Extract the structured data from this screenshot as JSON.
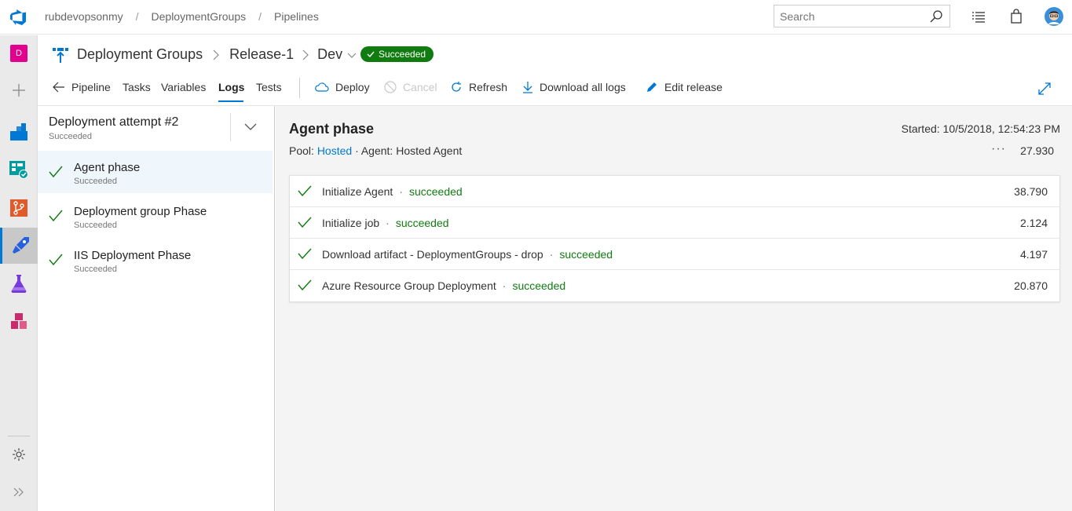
{
  "topbar": {
    "breadcrumbs": [
      "rubdevopsonmy",
      "DeploymentGroups",
      "Pipelines"
    ],
    "search_placeholder": "Search"
  },
  "leftnav": {
    "project_initial": "D"
  },
  "header": {
    "crumbs": [
      "Deployment Groups",
      "Release-1",
      "Dev"
    ],
    "status": "Succeeded"
  },
  "toolbar": {
    "back_label": "Pipeline",
    "tabs": [
      "Tasks",
      "Variables",
      "Logs",
      "Tests"
    ],
    "active_tab": "Logs",
    "deploy": "Deploy",
    "cancel": "Cancel",
    "refresh": "Refresh",
    "download": "Download all logs",
    "edit": "Edit release"
  },
  "attempt": {
    "title": "Deployment attempt #2",
    "status": "Succeeded"
  },
  "phases": [
    {
      "name": "Agent phase",
      "status": "Succeeded"
    },
    {
      "name": "Deployment group Phase",
      "status": "Succeeded"
    },
    {
      "name": "IIS Deployment Phase",
      "status": "Succeeded"
    }
  ],
  "detail": {
    "title": "Agent phase",
    "started": "Started: 10/5/2018, 12:54:23 PM",
    "pool_label": "Pool:",
    "pool_value": "Hosted",
    "agent_text": "Agent: Hosted Agent",
    "more": "···",
    "duration": "27.930",
    "tasks": [
      {
        "name": "Initialize Agent",
        "status": "succeeded",
        "duration": "38.790"
      },
      {
        "name": "Initialize job",
        "status": "succeeded",
        "duration": "2.124"
      },
      {
        "name": "Download artifact - DeploymentGroups - drop",
        "status": "succeeded",
        "duration": "4.197"
      },
      {
        "name": "Azure Resource Group Deployment",
        "status": "succeeded",
        "duration": "20.870"
      }
    ]
  },
  "colors": {
    "accent": "#0078d4",
    "success": "#107c10",
    "project": "#e3008c"
  }
}
